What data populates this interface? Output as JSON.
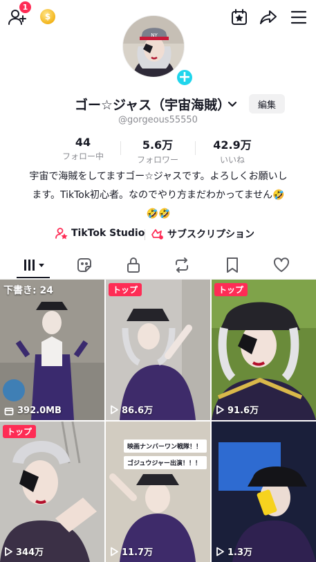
{
  "topbar": {
    "add_friend_icon": "add-friend-icon",
    "notification_count": "1",
    "coin_symbol": "$",
    "icons": [
      "calendar-star-icon",
      "share-icon",
      "menu-icon"
    ]
  },
  "profile": {
    "avatar_add_symbol": "+",
    "name": "ゴー☆ジャス（宇宙海賊）",
    "edit_label": "編集",
    "handle": "@gorgeous55550",
    "stats": [
      {
        "num": "44",
        "label": "フォロー中"
      },
      {
        "num": "5.6万",
        "label": "フォロワー"
      },
      {
        "num": "42.9万",
        "label": "いいね"
      }
    ],
    "bio": "宇宙で海賊をしてますゴー☆ジャスです。よろしくお願いします。TikTok初心者。なのでやり方まだわかってません🤣🤣🤣"
  },
  "links": {
    "studio": "TikTok Studio",
    "subscription": "サブスクリプション"
  },
  "tabs": [
    "videos-tab",
    "favorites-tab",
    "private-tab",
    "reposts-tab",
    "saved-tab",
    "liked-tab"
  ],
  "grid": {
    "draft_label": "下書き: 24",
    "top_tag": "トップ",
    "caption_line1": "映画ナンバーワン戦隊！！",
    "caption_line2": "ゴジュウジャー出演！！！",
    "cells": [
      {
        "views": "392.0MB",
        "kind": "draft"
      },
      {
        "views": "86.6万",
        "kind": "top"
      },
      {
        "views": "91.6万",
        "kind": "top"
      },
      {
        "views": "344万",
        "kind": "top"
      },
      {
        "views": "11.7万",
        "kind": "caption"
      },
      {
        "views": "1.3万",
        "kind": "plain"
      }
    ]
  },
  "colors": {
    "accent": "#fe2c55",
    "cyan": "#20d5ec",
    "muted": "#8a8b91"
  }
}
